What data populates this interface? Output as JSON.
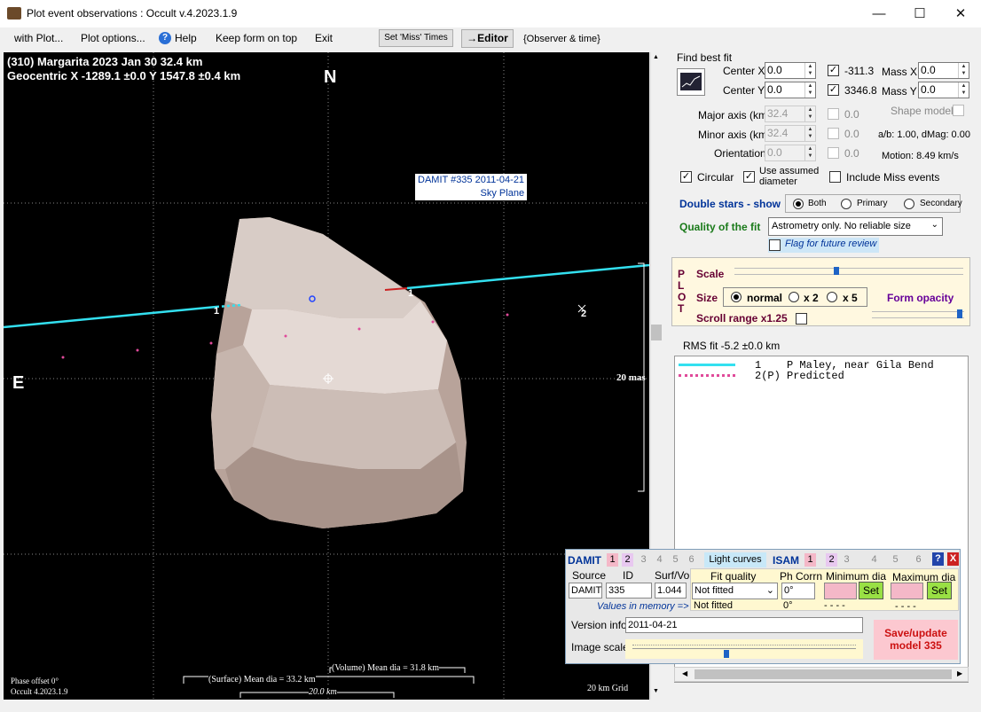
{
  "window": {
    "title": "Plot event observations : Occult v.4.2023.1.9",
    "minimize": "—",
    "maximize": "☐",
    "close": "✕"
  },
  "menu": {
    "with_plot": "with Plot...",
    "plot_options": "Plot options...",
    "help": "Help",
    "keep_on_top": "Keep form on top",
    "exit": "Exit",
    "set_miss": "Set 'Miss' Times",
    "editor": "→Editor",
    "observer_time": "{Observer & time}"
  },
  "plot": {
    "line1": "(310) Margarita  2023 Jan 30   32.4 km",
    "line2": "Geocentric  X  -1289.1 ±0.0  Y 1547.8 ±0.4 km",
    "north": "N",
    "east": "E",
    "damit_label1": "DAMIT #335 2011-04-21",
    "damit_label2": "Sky Plane",
    "mas": "20 mas",
    "phase": "Phase offset 0°",
    "version": "Occult 4.2023.1.9",
    "vol": "(Volume) Mean dia = 31.8 km",
    "surf": "(Surface) Mean dia = 33.2 km",
    "km20": "20.0 km",
    "grid": "20 km Grid",
    "chord1": "1",
    "chord1b": "1",
    "chord2": "2"
  },
  "fit": {
    "find_best": "Find best fit",
    "center_x_label": "Center X",
    "center_x": "0.0",
    "center_y_label": "Center Y",
    "center_y": "0.0",
    "x_val": "-311.3",
    "y_val": "3346.8",
    "mass_x_label": "Mass X",
    "mass_x": "0.0",
    "mass_y_label": "Mass Y",
    "mass_y": "0.0",
    "major_label": "Major axis (km)",
    "major": "32.4",
    "minor_label": "Minor axis (km)",
    "minor": "32.4",
    "orient_label": "Orientation",
    "orient": "0.0",
    "d1": "0.0",
    "d2": "0.0",
    "d3": "0.0",
    "shape_model": "Shape model",
    "ab": "a/b: 1.00, dMag: 0.00",
    "motion": "Motion: 8.49 km/s",
    "circular": "Circular",
    "use_assumed": "Use assumed diameter",
    "include_miss": "Include Miss events",
    "double_stars": "Double stars - show",
    "both": "Both",
    "primary": "Primary",
    "secondary": "Secondary",
    "quality_label": "Quality of the fit",
    "quality": "Astrometry only. No reliable size",
    "flag": "Flag for future review"
  },
  "plotbox": {
    "plot_vertical": "PLOT",
    "scale": "Scale",
    "size": "Size",
    "normal": "normal",
    "x2": "x 2",
    "x5": "x 5",
    "form_opacity": "Form opacity",
    "scroll_range": "Scroll range x1.25"
  },
  "rms": "RMS fit -5.2 ±0.0 km",
  "legend": [
    {
      "num": "1",
      "name": "P Maley, near Gila Bend"
    },
    {
      "num": "2(P)",
      "name": "Predicted"
    }
  ],
  "damit": {
    "damit": "DAMIT",
    "light_curves": "Light curves",
    "isam": "ISAM",
    "source_h": "Source",
    "id_h": "ID",
    "surf_h": "Surf/Vol",
    "fitq_h": "Fit quality",
    "phcorr_h": "Ph Corrn",
    "mindia_h": "Minimum dia",
    "maxdia_h": "Maximum dia",
    "source": "DAMIT",
    "id": "335",
    "surf": "1.044",
    "fitq": "Not fitted",
    "phcorr": "0°",
    "set1": "Set",
    "set2": "Set",
    "values_mem": "Values in memory =>",
    "mem_fit": "Not fitted",
    "mem_ph": "0°",
    "mem_min": "- - - -",
    "mem_max": "- - - -",
    "version_label": "Version info",
    "version": "2011-04-21",
    "image_scale": "Image scale",
    "save": "Save/update model 335",
    "help": "?",
    "close": "X"
  }
}
